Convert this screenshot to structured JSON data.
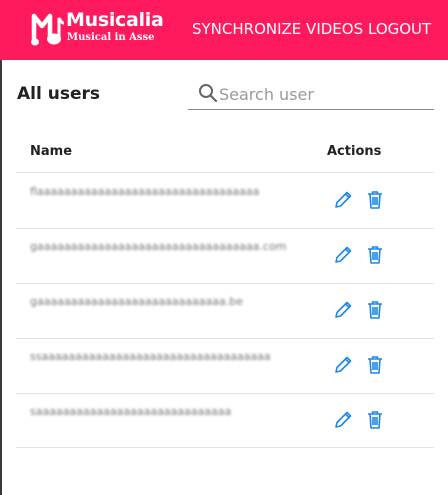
{
  "brand": {
    "name": "Musicalia",
    "tagline": "Musical in Asse",
    "logo_icon": "music-note-logo-icon",
    "accent_color": "#ff1a5e"
  },
  "nav": {
    "sync_label": "SYNCHRONIZE VIDEOS",
    "logout_label": "LOGOUT"
  },
  "page": {
    "title": "All users"
  },
  "search": {
    "placeholder": "Search user",
    "value": ""
  },
  "table": {
    "columns": [
      "Name",
      "Actions"
    ],
    "rows": [
      {
        "name": "flaaaaaaaaaaaaaaaaaaaaaaaaaaaaaaaaa",
        "edit_icon": "pencil-icon",
        "delete_icon": "trash-icon"
      },
      {
        "name": "gaaaaaaaaaaaaaaaaaaaaaaaaaaaaaaaaa.com",
        "edit_icon": "pencil-icon",
        "delete_icon": "trash-icon"
      },
      {
        "name": "gaaaaaaaaaaaaaaaaaaaaaaaaaaaa.be",
        "edit_icon": "pencil-icon",
        "delete_icon": "trash-icon"
      },
      {
        "name": "ssaaaaaaaaaaaaaaaaaaaaaaaaaaaaaaaaaa",
        "edit_icon": "pencil-icon",
        "delete_icon": "trash-icon"
      },
      {
        "name": "saaaaaaaaaaaaaaaaaaaaaaaaaaaaa",
        "edit_icon": "pencil-icon",
        "delete_icon": "trash-icon"
      }
    ],
    "action_color": "#1e88e5"
  }
}
